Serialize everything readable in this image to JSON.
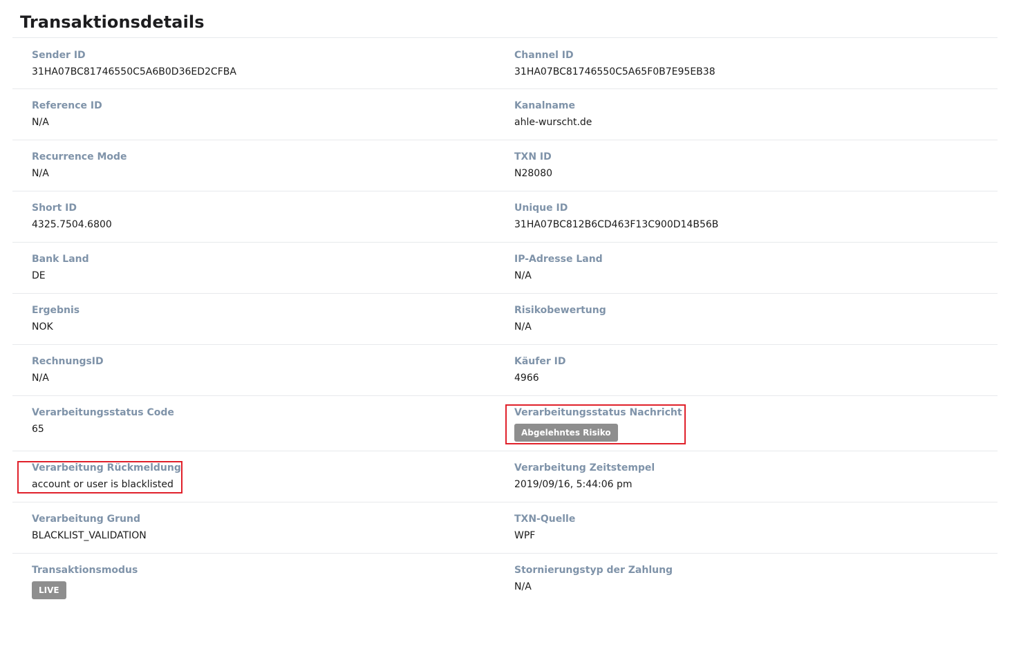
{
  "page_title": "Transaktionsdetails",
  "fields": {
    "sender_id": {
      "label": "Sender ID",
      "value": "31HA07BC81746550C5A6B0D36ED2CFBA"
    },
    "channel_id": {
      "label": "Channel ID",
      "value": "31HA07BC81746550C5A65F0B7E95EB38"
    },
    "reference_id": {
      "label": "Reference ID",
      "value": "N/A"
    },
    "kanalname": {
      "label": "Kanalname",
      "value": "ahle-wurscht.de"
    },
    "recurrence_mode": {
      "label": "Recurrence Mode",
      "value": "N/A"
    },
    "txn_id": {
      "label": "TXN ID",
      "value": "N28080"
    },
    "short_id": {
      "label": "Short ID",
      "value": "4325.7504.6800"
    },
    "unique_id": {
      "label": "Unique ID",
      "value": "31HA07BC812B6CD463F13C900D14B56B"
    },
    "bank_land": {
      "label": "Bank Land",
      "value": "DE"
    },
    "ip_adresse_land": {
      "label": "IP-Adresse Land",
      "value": "N/A"
    },
    "ergebnis": {
      "label": "Ergebnis",
      "value": "NOK"
    },
    "risikobewertung": {
      "label": "Risikobewertung",
      "value": "N/A"
    },
    "rechnungs_id": {
      "label": "RechnungsID",
      "value": "N/A"
    },
    "kaeufer_id": {
      "label": "Käufer ID",
      "value": "4966"
    },
    "verarbeitungsstatus_code": {
      "label": "Verarbeitungsstatus Code",
      "value": "65"
    },
    "verarbeitungsstatus_nachricht": {
      "label": "Verarbeitungsstatus Nachricht",
      "badge": "Abgelehntes Risiko"
    },
    "verarbeitung_rueckmeldung": {
      "label": "Verarbeitung Rückmeldung",
      "value": "account or user is blacklisted"
    },
    "verarbeitung_zeitstempel": {
      "label": "Verarbeitung Zeitstempel",
      "value": "2019/09/16, 5:44:06 pm"
    },
    "verarbeitung_grund": {
      "label": "Verarbeitung Grund",
      "value": "BLACKLIST_VALIDATION"
    },
    "txn_quelle": {
      "label": "TXN-Quelle",
      "value": "WPF"
    },
    "transaktionsmodus": {
      "label": "Transaktionsmodus",
      "badge": "LIVE"
    },
    "stornierungstyp": {
      "label": "Stornierungstyp der Zahlung",
      "value": "N/A"
    }
  },
  "colors": {
    "label": "#7f93a9",
    "badge_bg": "#8e8e8e",
    "highlight": "#e0202a",
    "divider": "#e7e9ec"
  }
}
